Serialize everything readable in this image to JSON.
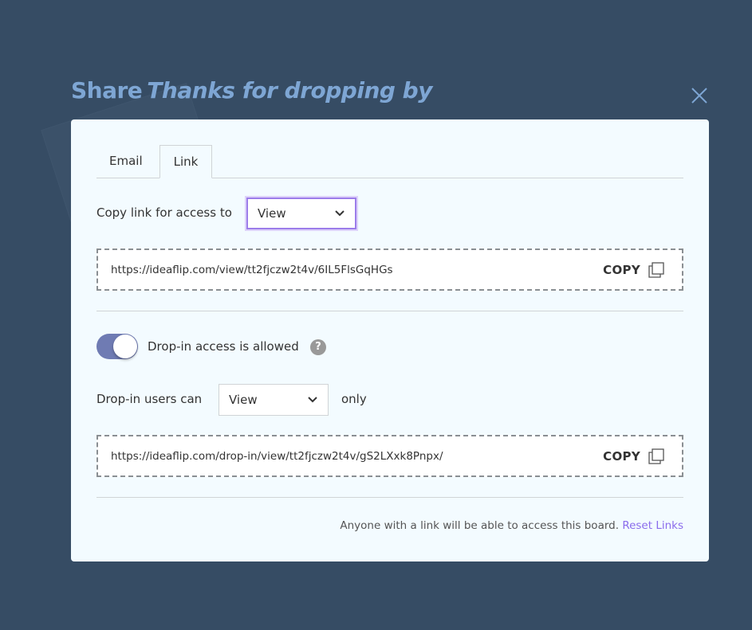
{
  "header": {
    "title_prefix": "Share",
    "board_name": "Thanks for dropping by",
    "close_icon": "close-icon"
  },
  "tabs": [
    {
      "label": "Email",
      "active": false
    },
    {
      "label": "Link",
      "active": true
    }
  ],
  "link_section": {
    "access_label": "Copy link for access to",
    "access_select": {
      "value": "View",
      "icon": "chevron-down-icon"
    },
    "url": "https://ideaflip.com/view/tt2fjczw2t4v/6IL5FlsGqHGs",
    "copy_label": "COPY",
    "copy_icon": "copy-icon"
  },
  "dropin_section": {
    "toggle_on": true,
    "toggle_label": "Drop-in access is allowed",
    "help_icon": "?",
    "users_can_label": "Drop-in users can",
    "users_select": {
      "value": "View",
      "icon": "chevron-down-icon"
    },
    "only_label": "only",
    "url": "https://ideaflip.com/drop-in/view/tt2fjczw2t4v/gS2LXxk8Pnpx/",
    "copy_label": "COPY",
    "copy_icon": "copy-icon"
  },
  "footer": {
    "note": "Anyone with a link will be able to access this board.",
    "reset_link": "Reset Links"
  },
  "colors": {
    "background": "#364c64",
    "title": "#7ea6d4",
    "accent": "#8b6cec",
    "toggle": "#6f7bb3"
  }
}
